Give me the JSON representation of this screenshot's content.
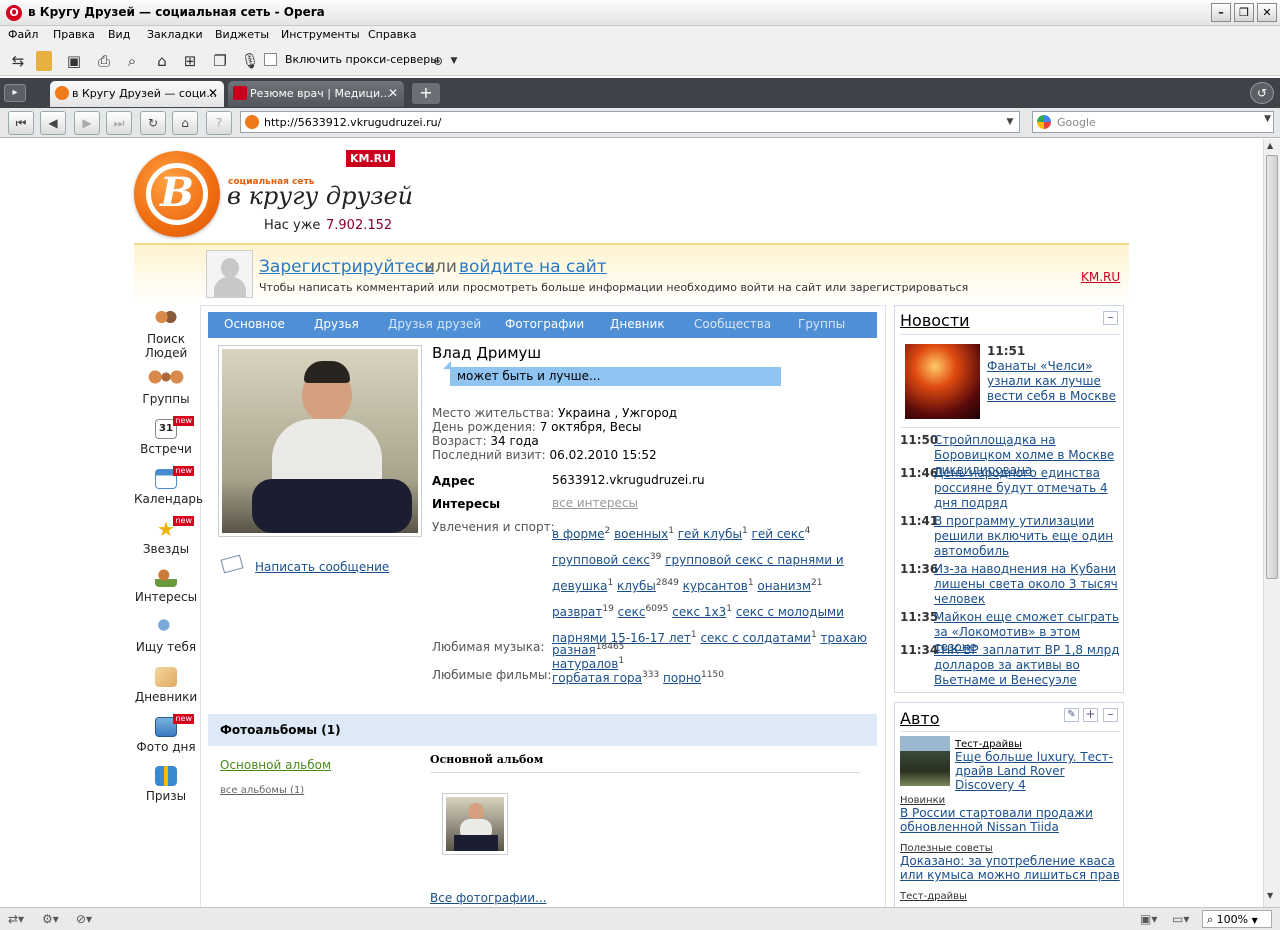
{
  "window": {
    "title": "в Кругу Друзей — социальная сеть - Opera",
    "controls": [
      "–",
      "❐",
      "✕"
    ]
  },
  "menu": [
    "Файл",
    "Правка",
    "Вид",
    "Закладки",
    "Виджеты",
    "Инструменты",
    "Справка"
  ],
  "toolbar": {
    "proxy_label": "Включить прокси-серверы"
  },
  "tabs": [
    {
      "label": "в Кругу Друзей — соци...",
      "close": "✕"
    },
    {
      "label": "Резюме врач | Медици...",
      "close": "✕"
    }
  ],
  "address": {
    "url": "http://5633912.vkrugudruzei.ru/",
    "search_placeholder": "Google"
  },
  "site": {
    "logo_sub": "социальная сеть",
    "logo_main": "в кругу друзей",
    "km_badge": "KM.RU",
    "count_label": "Нас уже",
    "count_value": "7.902.152"
  },
  "banner": {
    "register": "Зарегистрируйтесь",
    "or": "или",
    "login": "войдите на сайт",
    "hint": "Чтобы написать комментарий или просмотреть больше информации необходимо войти на сайт или зарегистрироваться",
    "km_link": "KM.RU"
  },
  "sidebar": [
    {
      "label": "Поиск Людей"
    },
    {
      "label": "Группы"
    },
    {
      "label": "Встречи",
      "badge": "new"
    },
    {
      "label": "Календарь",
      "badge": "new"
    },
    {
      "label": "Звезды",
      "badge": "new"
    },
    {
      "label": "Интересы"
    },
    {
      "label": "Ищу тебя"
    },
    {
      "label": "Дневники"
    },
    {
      "label": "Фото дня",
      "badge": "new"
    },
    {
      "label": "Призы"
    }
  ],
  "profile_tabs": [
    "Основное",
    "Друзья",
    "Друзья друзей",
    "Фотографии",
    "Дневник",
    "Сообщества",
    "Группы"
  ],
  "profile": {
    "name": "Влад Дримуш",
    "status": "может быть и лучше...",
    "write_message": "Написать сообщение",
    "fields": [
      {
        "label": "Место жительства:",
        "value": "Украина , Ужгород"
      },
      {
        "label": "День рождения:",
        "value": "7 октября, Весы"
      },
      {
        "label": "Возраст:",
        "value": "34 года"
      },
      {
        "label": "Последний визит:",
        "value": "06.02.2010 15:52"
      }
    ],
    "address_label": "Адрес",
    "address_value": "5633912.vkrugudruzei.ru",
    "interests_label": "Интересы",
    "interests_all": "все интересы",
    "hobbies_label": "Увлечения и спорт:",
    "music_label": "Любимая музыка:",
    "films_label": "Любимые фильмы:",
    "hobbies": [
      {
        "t": "в форме",
        "n": "2"
      },
      {
        "t": "военных",
        "n": "1"
      },
      {
        "t": "гей клубы",
        "n": "1"
      },
      {
        "t": "гей секс",
        "n": "4"
      },
      {
        "t": "групповой секс",
        "n": "39"
      },
      {
        "t": "групповой секс с парнями и девушка",
        "n": "1"
      },
      {
        "t": "клубы",
        "n": "2849"
      },
      {
        "t": "курсантов",
        "n": "1"
      },
      {
        "t": "онанизм",
        "n": "21"
      },
      {
        "t": "разврат",
        "n": "19"
      },
      {
        "t": "секс",
        "n": "6095"
      },
      {
        "t": "секс 1х3",
        "n": "1"
      },
      {
        "t": "секс с молодыми парнями 15-16-17 лет",
        "n": "1"
      },
      {
        "t": "секс с солдатами",
        "n": "1"
      },
      {
        "t": "трахаю натуралов",
        "n": "1"
      }
    ],
    "music": [
      {
        "t": "разная",
        "n": "18465"
      }
    ],
    "films": [
      {
        "t": "горбатая гора",
        "n": "333"
      },
      {
        "t": "порно",
        "n": "1150"
      }
    ]
  },
  "albums": {
    "header": "Фотоальбомы (1)",
    "main_album": "Основной альбом",
    "all_albums": "все альбомы (1)",
    "album_title": "Основной альбом",
    "all_photos": "Все фотографии..."
  },
  "news": {
    "title": "Новости",
    "top_time": "11:51",
    "top_text": "Фанаты «Челси» узнали как лучше вести себя в Москве",
    "items": [
      {
        "time": "11:50",
        "text": "Стройплощадка на Боровицком холме в Москве ликвидирована"
      },
      {
        "time": "11:46",
        "text": "День народного единства россияне будут отмечать 4 дня подряд"
      },
      {
        "time": "11:41",
        "text": "В программу утилизации решили включить еще один автомобиль"
      },
      {
        "time": "11:36",
        "text": "Из-за наводнения на Кубани лишены света около 3 тысяч человек"
      },
      {
        "time": "11:35",
        "text": "Майкон еще сможет сыграть за «Локомотив» в этом сезоне"
      },
      {
        "time": "11:34",
        "text": "ТНК-ВР заплатит ВР 1,8 млрд долларов за активы во Вьетнаме и Венесуэле"
      }
    ]
  },
  "auto": {
    "title": "Авто",
    "items": [
      {
        "cat": "Тест-драйвы",
        "text": "Еще больше luxury. Тест-драйв Land Rover Discovery 4"
      },
      {
        "cat": "Новинки",
        "text": "В России стартовали продажи обновленной Nissan Tiida"
      },
      {
        "cat": "Полезные советы",
        "text": "Доказано: за употребление кваса или кумыса можно лишиться прав"
      },
      {
        "cat": "Тест-драйвы",
        "text": ""
      }
    ]
  },
  "status": {
    "zoom": "100%"
  },
  "colors": {
    "brand_orange": "#f07a1a",
    "nav_blue": "#4a90d9",
    "link": "#1a4f8a",
    "km_red": "#c8001e"
  }
}
